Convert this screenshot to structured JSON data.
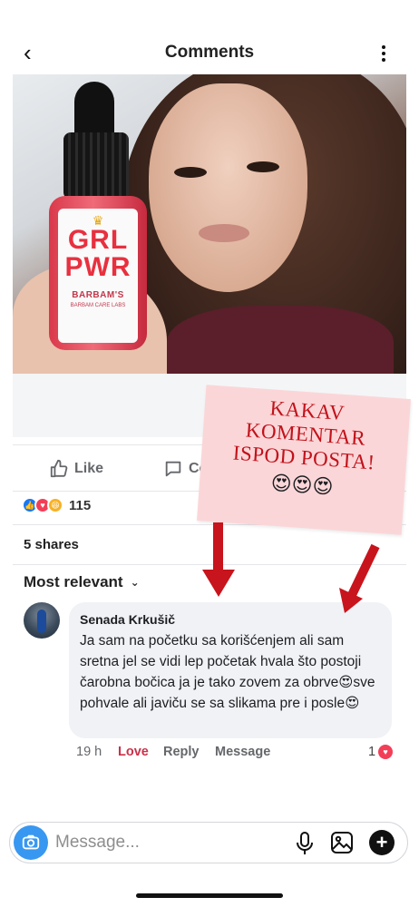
{
  "header": {
    "title": "Comments"
  },
  "post": {
    "bottle_label": {
      "line1": "GRL",
      "line2": "PWR",
      "brand": "BARBAM'S",
      "sub": "BARBAM CARE LABS"
    }
  },
  "actions": {
    "like_label": "Like",
    "comment_label": "Co"
  },
  "reactions": {
    "count": "115",
    "types": [
      "like",
      "love",
      "haha"
    ]
  },
  "shares": {
    "label": "5 shares"
  },
  "sort": {
    "label": "Most relevant"
  },
  "comment": {
    "author": "Senada Krkušič",
    "text": "Ja sam na početku sa korišćenjem ali sam sretna jel se vidi lep početak hvala što postoji čarobna bočica ja je tako zovem za obrve😍sve pohvale ali javiču se sa slikama pre i posle😍",
    "time": "19 h",
    "love_label": "Love",
    "reply_label": "Reply",
    "message_label": "Message",
    "reaction_count": "1"
  },
  "overlay_note": {
    "line1": "KAKAV",
    "line2": "KOMENTAR",
    "line3": "ISPOD POSTA!",
    "emoji": "😍😍😍",
    "text_color": "#c2121b",
    "background": "#fbd6d8"
  },
  "message_bar": {
    "placeholder": "Message..."
  },
  "colors": {
    "accent_blue": "#3897f0",
    "love_red": "#c9324a",
    "arrow_red": "#c8141c"
  }
}
